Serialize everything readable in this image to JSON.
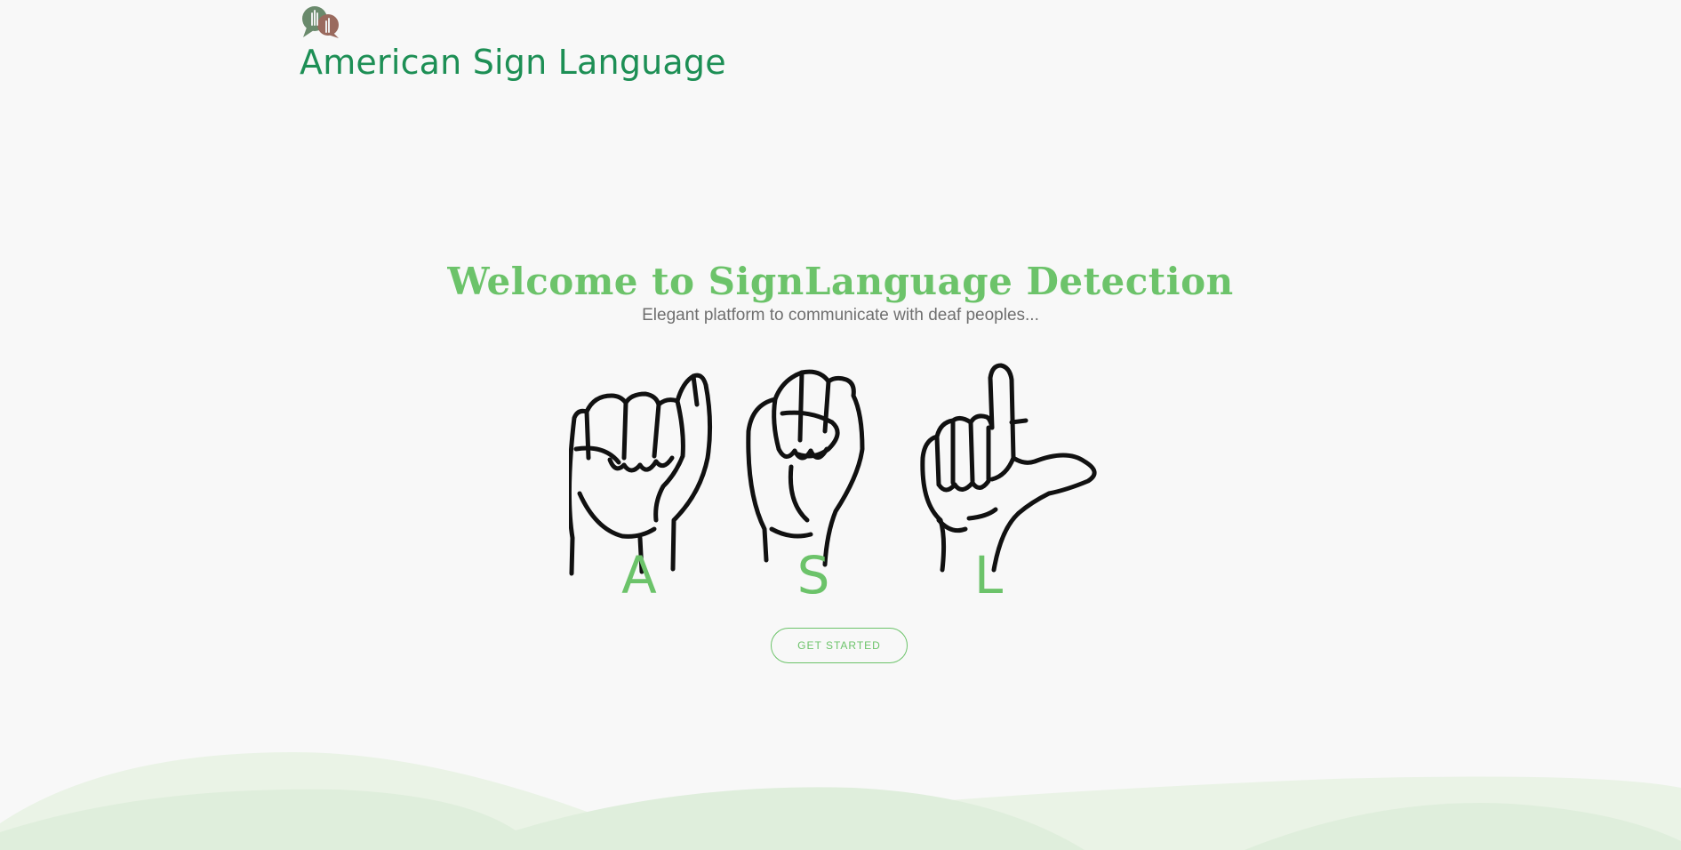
{
  "header": {
    "brand_title": "American Sign Language",
    "logo_icon": "two-hands-speech-bubbles-logo"
  },
  "hero": {
    "title": "Welcome to SignLanguage Detection",
    "subtitle": "Elegant platform to communicate with deaf peoples...",
    "signs": [
      {
        "letter": "A",
        "icon": "asl-letter-a-hand-icon"
      },
      {
        "letter": "S",
        "icon": "asl-letter-s-hand-icon"
      },
      {
        "letter": "L",
        "icon": "asl-letter-l-hand-icon"
      }
    ],
    "cta_label": "GET STARTED"
  },
  "colors": {
    "brand_green": "#1d8f55",
    "accent_green": "#6cc36a",
    "subtitle_gray": "#6f6f6f",
    "background": "#f8f8f8",
    "wave_light": "#eaf3e6",
    "wave_mid": "#dfeedc"
  }
}
